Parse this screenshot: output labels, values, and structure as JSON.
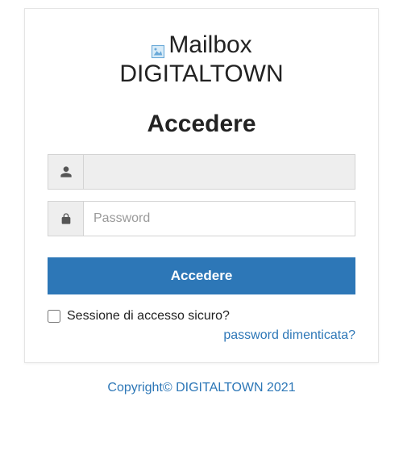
{
  "brand": {
    "line1": "Mailbox",
    "line2": "DIGITALTOWN"
  },
  "login": {
    "title": "Accedere",
    "username_placeholder": "",
    "username_value": "",
    "password_placeholder": "Password",
    "password_value": "",
    "submit_label": "Accedere",
    "secure_session_label": "Sessione di accesso sicuro?",
    "forgot_password_label": "password dimenticata?"
  },
  "footer": {
    "text": "Copyright© DIGITALTOWN 2021"
  },
  "colors": {
    "primary": "#2d77b7"
  }
}
